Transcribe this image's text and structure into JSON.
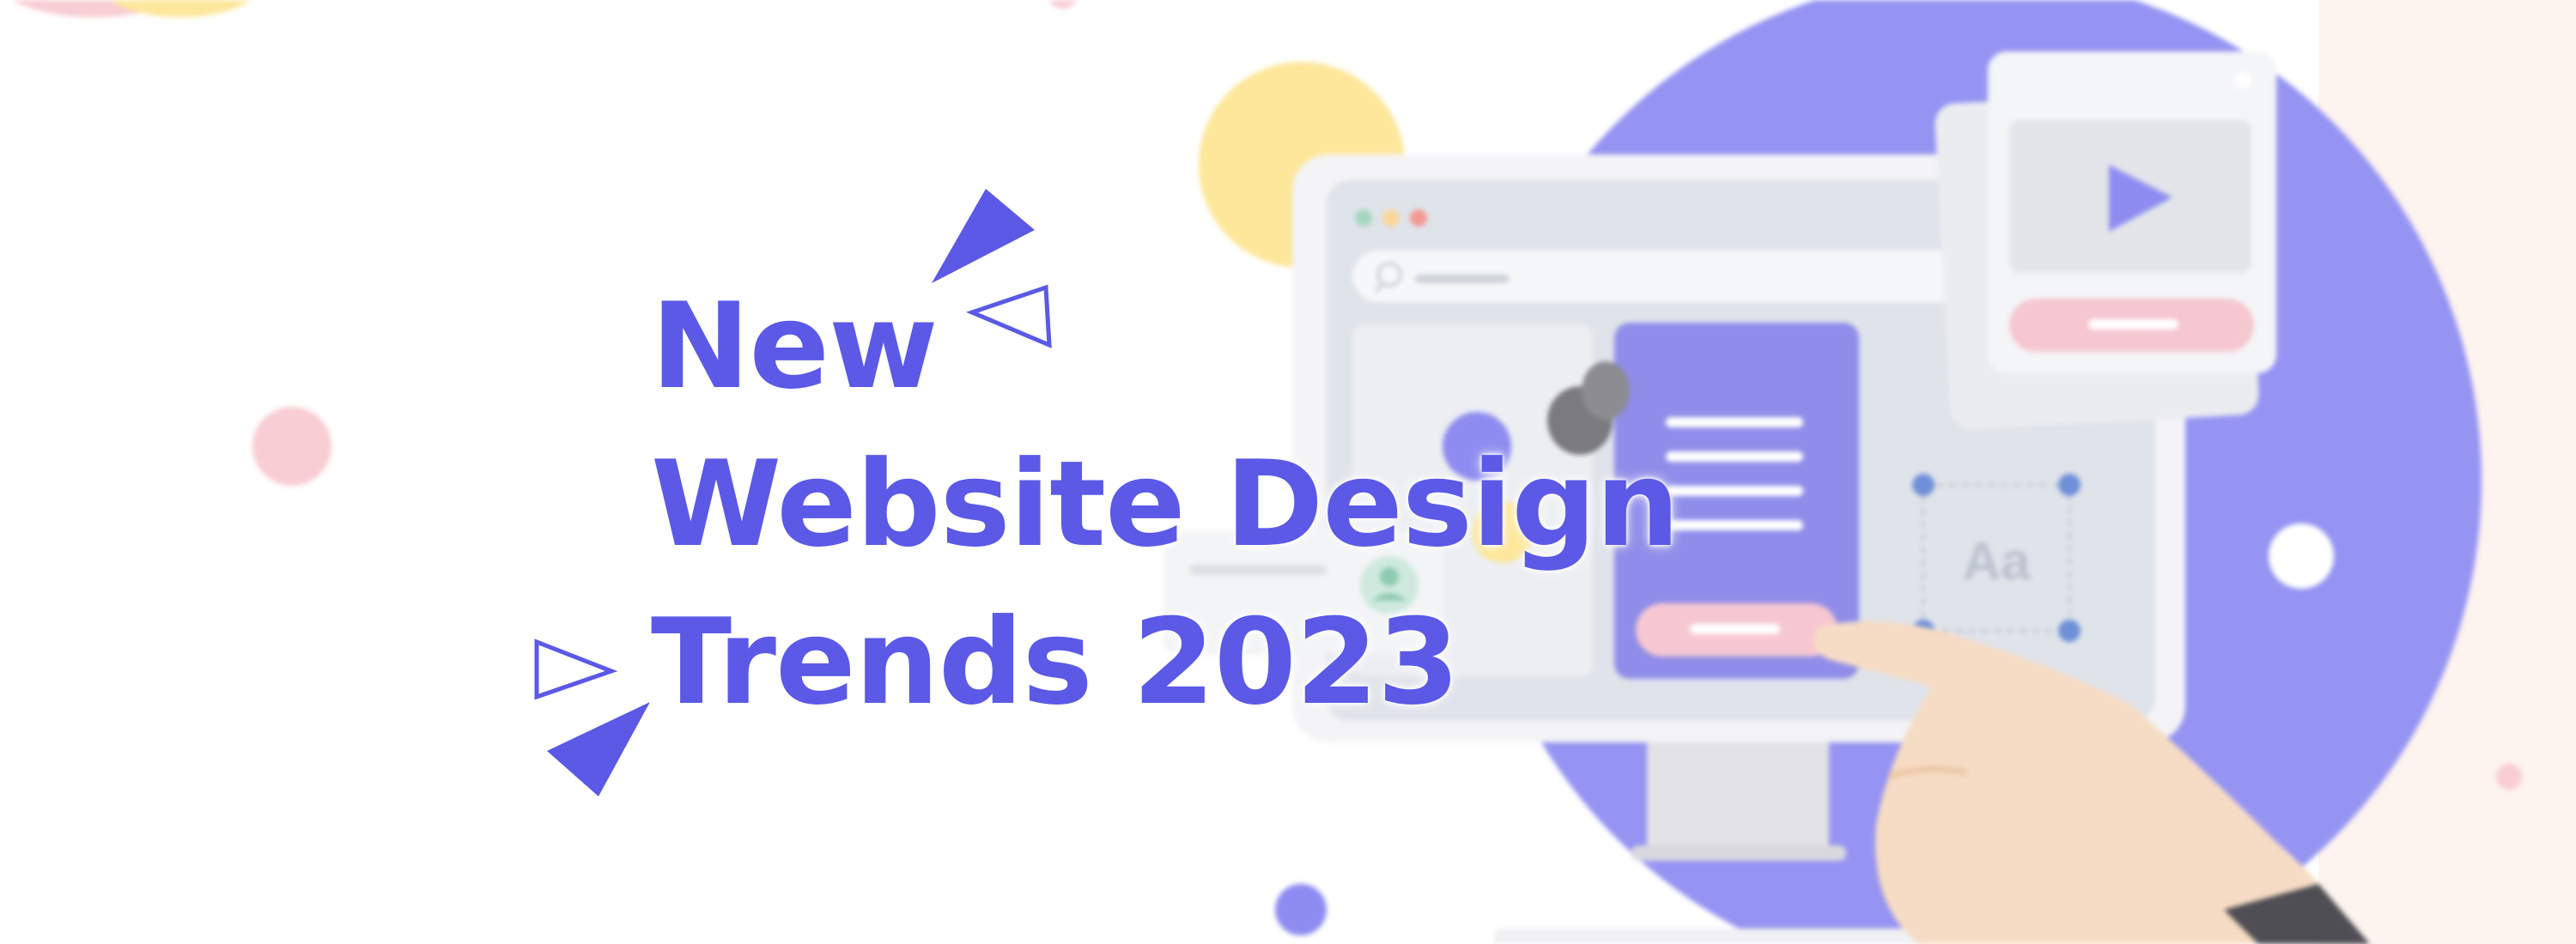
{
  "banner": {
    "headline_line1": "New",
    "headline_line2": "Website Design",
    "headline_line3": "Trends 2023",
    "illustration_text": "Aa"
  },
  "icons": [
    "triangle-icon",
    "play-icon",
    "search-icon",
    "user-icon",
    "hand-pointer-icon",
    "pin-icon"
  ],
  "colors": {
    "accent": "#5b59e6",
    "purple_circle": "#9594f2",
    "yellow": "#fde79a",
    "pink": "#f8cdd3",
    "background_margin": "#fdf3ef",
    "panel": "#ffffff"
  }
}
